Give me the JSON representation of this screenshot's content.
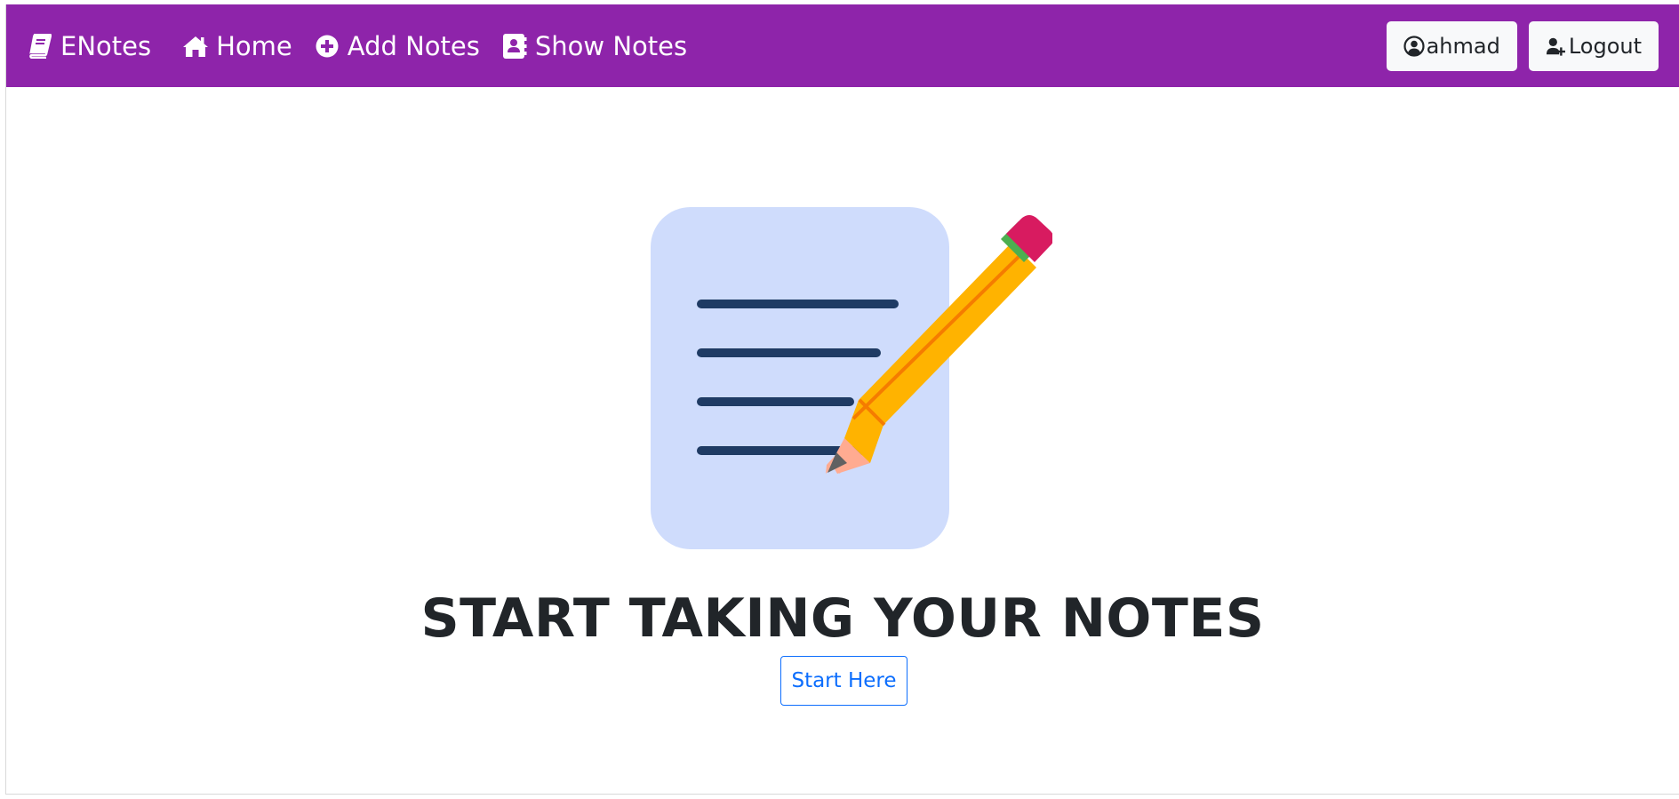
{
  "nav": {
    "brand": "ENotes",
    "links": [
      {
        "label": "Home",
        "icon": "home-icon"
      },
      {
        "label": "Add Notes",
        "icon": "plus-circle-icon"
      },
      {
        "label": "Show Notes",
        "icon": "address-book-icon"
      }
    ],
    "user_label": "ahmad",
    "logout_label": "Logout"
  },
  "hero": {
    "headline": "START TAKING YOUR NOTES",
    "cta_label": "Start Here"
  },
  "colors": {
    "navbar": "#8e24aa",
    "primary": "#0d6efd",
    "note_bg": "#cfdcfc",
    "note_lines": "#1f3b64",
    "pencil_body": "#ffb300",
    "eraser": "#d81b60",
    "band": "#43a047"
  }
}
